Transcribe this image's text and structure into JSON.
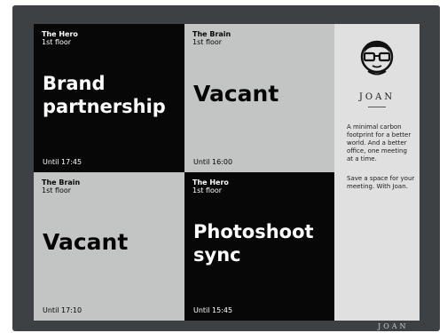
{
  "tiles": [
    {
      "room": "The Hero",
      "floor": "1st floor",
      "status": [
        "Brand",
        "partnership"
      ],
      "until": "Until 17:45",
      "theme": "dark"
    },
    {
      "room": "The Brain",
      "floor": "1st floor",
      "status": [
        "Vacant"
      ],
      "until": "Until 16:00",
      "theme": "light"
    },
    {
      "room": "The Brain",
      "floor": "1st floor",
      "status": [
        "Vacant"
      ],
      "until": "Until 17:10",
      "theme": "light"
    },
    {
      "room": "The Hero",
      "floor": "1st floor",
      "status": [
        "Photoshoot",
        "sync"
      ],
      "until": "Until 15:45",
      "theme": "dark"
    }
  ],
  "sidebar": {
    "logo_icon": "joan-face-logo-icon",
    "brand": "JOAN",
    "text1": [
      "A minimal carbon",
      "footprint for a better",
      "world. And a better",
      "office, one meeting",
      "at a time."
    ],
    "text2": [
      "Save a space for your",
      "meeting. With Joan."
    ]
  },
  "bezel_brand": "JOAN",
  "colors": {
    "dark_tile": "#070707",
    "light_tile": "#c3c4c4",
    "sidebar": "#dfe0df",
    "bezel": "#3e4143"
  }
}
